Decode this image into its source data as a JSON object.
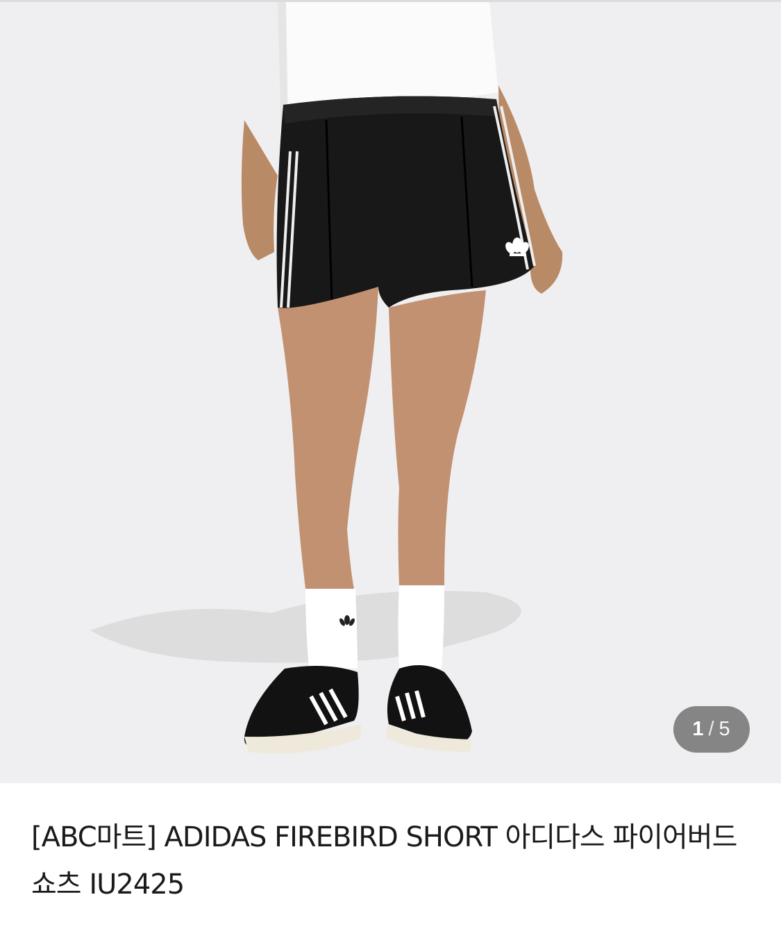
{
  "gallery": {
    "current_index": "1",
    "separator": "/",
    "total": "5",
    "image_label": "product-photo"
  },
  "product": {
    "title": "[ABC마트] ADIDAS FIREBIRD SHORT 아디다스 파이어버드 쇼츠 IU2425"
  },
  "colors": {
    "gallery_background": "#efeff1",
    "counter_background": "#6e6e6e",
    "title_text": "#1a1a1a"
  }
}
